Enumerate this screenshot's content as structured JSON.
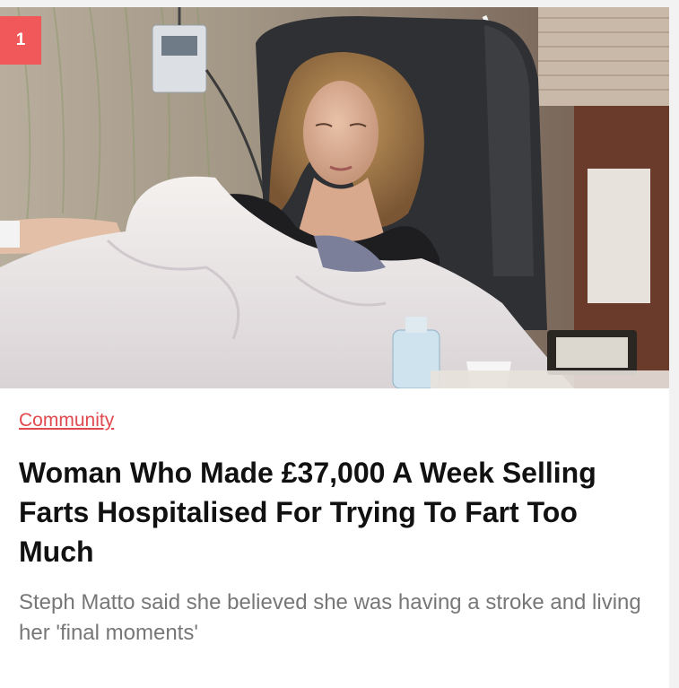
{
  "article": {
    "rank": "1",
    "category": "Community",
    "headline": "Woman Who Made £37,000 A Week Selling Farts Hospitalised For Trying To Fart Too Much",
    "standfirst": "Steph Matto said she believed she was having a stroke and living her 'final moments'"
  },
  "colors": {
    "badge": "#f0585a",
    "category": "#e04a4f",
    "headline": "#111111",
    "standfirst": "#777777",
    "background": "#f2f2f2"
  }
}
